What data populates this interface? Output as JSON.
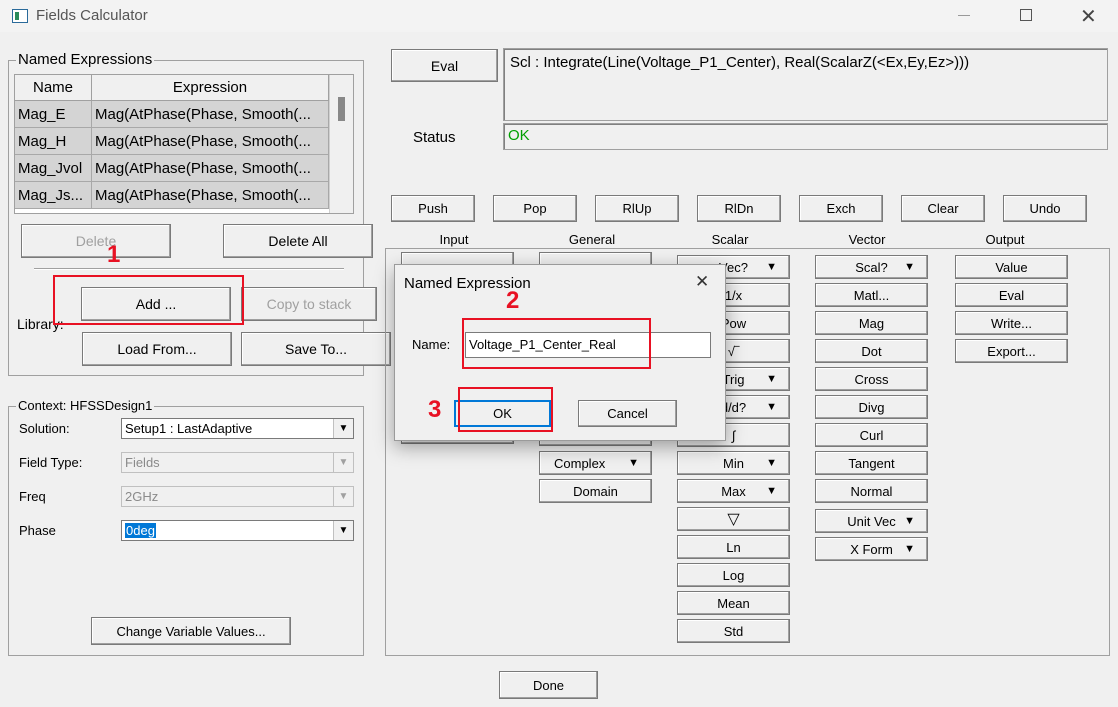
{
  "window": {
    "title": "Fields Calculator"
  },
  "named_expressions": {
    "title": "Named Expressions",
    "columns": [
      "Name",
      "Expression"
    ],
    "rows": [
      {
        "name": "Mag_E",
        "expression": "Mag(AtPhase(Phase, Smooth(..."
      },
      {
        "name": "Mag_H",
        "expression": "Mag(AtPhase(Phase, Smooth(..."
      },
      {
        "name": "Mag_Jvol",
        "expression": "Mag(AtPhase(Phase, Smooth(..."
      },
      {
        "name": "Mag_Js...",
        "expression": "Mag(AtPhase(Phase, Smooth(..."
      }
    ],
    "delete_label": "Delete",
    "delete_all_label": "Delete All",
    "add_label": "Add ...",
    "copy_label": "Copy to stack",
    "library_label": "Library:",
    "load_label": "Load From...",
    "save_label": "Save To..."
  },
  "context": {
    "title": "Context: HFSSDesign1",
    "solution_label": "Solution:",
    "solution_value": "Setup1 : LastAdaptive",
    "fieldtype_label": "Field Type:",
    "fieldtype_value": "Fields",
    "freq_label": "Freq",
    "freq_value": "2GHz",
    "phase_label": "Phase",
    "phase_value": "0deg",
    "change_label": "Change Variable Values..."
  },
  "eval": {
    "button": "Eval",
    "expression": "Scl : Integrate(Line(Voltage_P1_Center), Real(ScalarZ(<Ex,Ey,Ez>)))",
    "status_label": "Status",
    "status_value": "OK"
  },
  "stack_buttons": [
    "Push",
    "Pop",
    "RlUp",
    "RlDn",
    "Exch",
    "Clear",
    "Undo"
  ],
  "sections": {
    "input": "Input",
    "general": "General",
    "scalar": "Scalar",
    "vector": "Vector",
    "output": "Output"
  },
  "general_buttons": [
    "Complex",
    "Domain"
  ],
  "scalar_top": [
    "Vec?",
    "1/x",
    "Pow",
    "√‾",
    "Trig",
    "d/d?",
    "∫"
  ],
  "scalar_buttons": [
    "Min",
    "Max",
    "▽",
    "Ln",
    "Log",
    "Mean",
    "Std"
  ],
  "vector_buttons": [
    "Scal?",
    "Matl...",
    "Mag",
    "Dot",
    "Cross",
    "Divg",
    "Curl",
    "Tangent",
    "Normal",
    "Unit Vec",
    "X Form"
  ],
  "output_buttons": [
    "Value",
    "Eval",
    "Write...",
    "Export..."
  ],
  "dialog": {
    "title": "Named Expression",
    "name_label": "Name:",
    "name_value": "Voltage_P1_Center_Real",
    "ok_label": "OK",
    "cancel_label": "Cancel"
  },
  "done_label": "Done",
  "annotations": [
    "1",
    "2",
    "3"
  ],
  "colors": {
    "status_ok": "#00a000",
    "annotation": "#e81123",
    "selection": "#0078d7"
  }
}
